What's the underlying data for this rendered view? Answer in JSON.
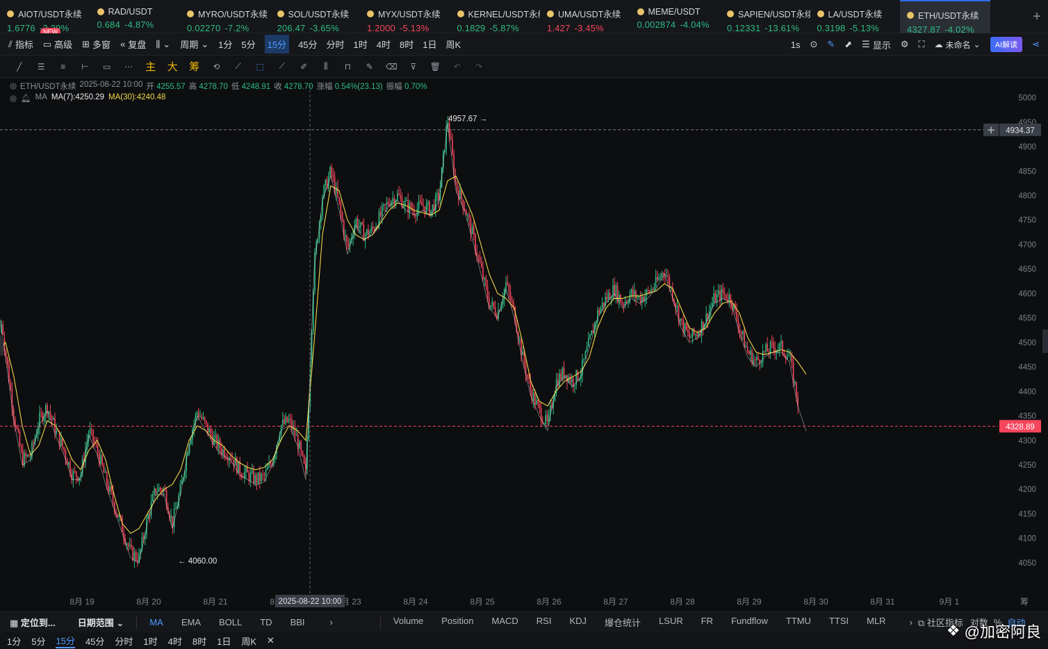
{
  "tickers": [
    {
      "symbol": "AIOT/USDT永续",
      "price": "1.6776",
      "change": "-3.39%",
      "price_color": "green"
    },
    {
      "symbol": "RAD/USDT",
      "price": "0.684",
      "change": "-4.87%",
      "price_color": "green"
    },
    {
      "symbol": "MYRO/USDT永续",
      "price": "0.02270",
      "change": "-7.2%",
      "price_color": "green"
    },
    {
      "symbol": "SOL/USDT永续",
      "price": "206.47",
      "change": "-3.65%",
      "price_color": "green"
    },
    {
      "symbol": "MYX/USDT永续",
      "price": "1.2000",
      "change": "-5.13%",
      "price_color": "red"
    },
    {
      "symbol": "KERNEL/USDT永续",
      "price": "0.1829",
      "change": "-5.87%",
      "price_color": "green"
    },
    {
      "symbol": "UMA/USDT永续",
      "price": "1.427",
      "change": "-3.45%",
      "price_color": "red"
    },
    {
      "symbol": "MEME/USDT",
      "price": "0.002874",
      "change": "-4.04%",
      "price_color": "green"
    },
    {
      "symbol": "SAPIEN/USDT永续",
      "price": "0.12331",
      "change": "-13.61%",
      "price_color": "green"
    },
    {
      "symbol": "LA/USDT永续",
      "price": "0.3198",
      "change": "-5.13%",
      "price_color": "green"
    },
    {
      "symbol": "ETH/USDT永续",
      "price": "4327.87",
      "change": "-4.02%",
      "price_color": "green"
    }
  ],
  "new_badge": "NEW",
  "toolbar": {
    "indicators": "指标",
    "advanced": "高级",
    "multi_window": "多窗",
    "replay": "复盘",
    "period": "周期",
    "periods": [
      "1分",
      "5分",
      "15分",
      "45分",
      "分时",
      "1时",
      "4时",
      "8时",
      "1日",
      "周K"
    ],
    "active_period": "15分",
    "interval": "1s",
    "display": "显示",
    "unnamed": "未命名",
    "ai": "AI解读"
  },
  "legend": {
    "symbol": "ETH/USDT永续",
    "time": "2025-08-22 10:00",
    "open_label": "开",
    "open": "4255.57",
    "high_label": "高",
    "high": "4278.70",
    "low_label": "低",
    "low": "4248.91",
    "close_label": "收",
    "close": "4278.70",
    "change_label": "涨幅",
    "change": "0.54%(23.13)",
    "amp_label": "振幅",
    "amp": "0.70%",
    "ma_label": "MA",
    "ma7": "MA(7):4250.29",
    "ma30": "MA(30):4240.48"
  },
  "chart_data": {
    "type": "candlestick",
    "symbol": "ETH/USDT永续",
    "interval": "15m",
    "y_ticks": [
      5000,
      4950,
      4900,
      4850,
      4800,
      4750,
      4700,
      4650,
      4600,
      4550,
      4500,
      4450,
      4400,
      4350,
      4300,
      4250,
      4200,
      4150,
      4100,
      4050
    ],
    "ylim": [
      4030,
      5015
    ],
    "x_labels": [
      "8月 19",
      "8月 20",
      "8月 21",
      "8月 22",
      "8月 23",
      "8月 24",
      "8月 25",
      "8月 26",
      "8月 27",
      "8月 28",
      "8月 29",
      "8月 30",
      "8月 31",
      "9月 1"
    ],
    "crosshair_time": "2025-08-22 10:00",
    "crosshair_price": "4934.37",
    "last_price": "4328.89",
    "max_annotation": "4957.67",
    "min_annotation": "4060.00",
    "series": [
      {
        "name": "MA(7)"
      },
      {
        "name": "MA(30)"
      }
    ],
    "price_path": [
      [
        0,
        4520
      ],
      [
        0.3,
        4560
      ],
      [
        1,
        4480
      ],
      [
        2,
        4350
      ],
      [
        3,
        4260
      ],
      [
        4,
        4270
      ],
      [
        5,
        4340
      ],
      [
        6,
        4370
      ],
      [
        7,
        4320
      ],
      [
        8,
        4280
      ],
      [
        9,
        4230
      ],
      [
        10,
        4230
      ],
      [
        11,
        4320
      ],
      [
        12,
        4280
      ],
      [
        13,
        4220
      ],
      [
        14,
        4170
      ],
      [
        15,
        4120
      ],
      [
        16,
        4070
      ],
      [
        17,
        4060
      ],
      [
        18,
        4140
      ],
      [
        19,
        4200
      ],
      [
        20,
        4200
      ],
      [
        21,
        4130
      ],
      [
        22,
        4200
      ],
      [
        23,
        4300
      ],
      [
        24,
        4360
      ],
      [
        25,
        4330
      ],
      [
        26,
        4300
      ],
      [
        27,
        4280
      ],
      [
        28,
        4270
      ],
      [
        29,
        4240
      ],
      [
        30,
        4230
      ],
      [
        31,
        4220
      ],
      [
        32,
        4225
      ],
      [
        33,
        4260
      ],
      [
        34,
        4330
      ],
      [
        35,
        4340
      ],
      [
        36,
        4300
      ],
      [
        37,
        4230
      ],
      [
        38,
        4660
      ],
      [
        39,
        4800
      ],
      [
        40,
        4850
      ],
      [
        41,
        4780
      ],
      [
        42,
        4690
      ],
      [
        43,
        4750
      ],
      [
        44,
        4720
      ],
      [
        45,
        4730
      ],
      [
        46,
        4760
      ],
      [
        47,
        4790
      ],
      [
        48,
        4800
      ],
      [
        49,
        4780
      ],
      [
        50,
        4770
      ],
      [
        51,
        4780
      ],
      [
        52,
        4770
      ],
      [
        53,
        4800
      ],
      [
        54,
        4957.67
      ],
      [
        55,
        4820
      ],
      [
        56,
        4780
      ],
      [
        57,
        4720
      ],
      [
        58,
        4650
      ],
      [
        59,
        4580
      ],
      [
        60,
        4560
      ],
      [
        61,
        4620
      ],
      [
        62,
        4560
      ],
      [
        63,
        4470
      ],
      [
        64,
        4400
      ],
      [
        65,
        4360
      ],
      [
        66,
        4330
      ],
      [
        67,
        4420
      ],
      [
        68,
        4440
      ],
      [
        69,
        4420
      ],
      [
        70,
        4440
      ],
      [
        71,
        4500
      ],
      [
        72,
        4560
      ],
      [
        73,
        4590
      ],
      [
        74,
        4610
      ],
      [
        75,
        4580
      ],
      [
        76,
        4600
      ],
      [
        77,
        4590
      ],
      [
        78,
        4600
      ],
      [
        79,
        4620
      ],
      [
        80,
        4650
      ],
      [
        81,
        4600
      ],
      [
        82,
        4540
      ],
      [
        83,
        4510
      ],
      [
        84,
        4520
      ],
      [
        85,
        4550
      ],
      [
        86,
        4590
      ],
      [
        87,
        4600
      ],
      [
        88,
        4590
      ],
      [
        89,
        4530
      ],
      [
        90,
        4480
      ],
      [
        91,
        4460
      ],
      [
        92,
        4480
      ],
      [
        93,
        4490
      ],
      [
        94,
        4490
      ],
      [
        95,
        4470
      ],
      [
        96,
        4380
      ],
      [
        97,
        4328.89
      ]
    ],
    "ma30_path": [
      [
        0,
        4480
      ],
      [
        1,
        4500
      ],
      [
        2,
        4430
      ],
      [
        3,
        4330
      ],
      [
        4,
        4270
      ],
      [
        5,
        4290
      ],
      [
        6,
        4340
      ],
      [
        7,
        4330
      ],
      [
        8,
        4300
      ],
      [
        9,
        4260
      ],
      [
        10,
        4240
      ],
      [
        11,
        4280
      ],
      [
        12,
        4300
      ],
      [
        13,
        4260
      ],
      [
        14,
        4190
      ],
      [
        15,
        4130
      ],
      [
        16,
        4110
      ],
      [
        17,
        4120
      ],
      [
        18,
        4150
      ],
      [
        19,
        4180
      ],
      [
        20,
        4200
      ],
      [
        21,
        4210
      ],
      [
        22,
        4240
      ],
      [
        23,
        4300
      ],
      [
        24,
        4330
      ],
      [
        25,
        4320
      ],
      [
        26,
        4300
      ],
      [
        27,
        4290
      ],
      [
        28,
        4270
      ],
      [
        29,
        4255
      ],
      [
        30,
        4245
      ],
      [
        31,
        4240
      ],
      [
        32,
        4245
      ],
      [
        33,
        4260
      ],
      [
        34,
        4300
      ],
      [
        35,
        4330
      ],
      [
        36,
        4320
      ],
      [
        37,
        4300
      ],
      [
        38,
        4500
      ],
      [
        39,
        4720
      ],
      [
        40,
        4820
      ],
      [
        41,
        4810
      ],
      [
        42,
        4750
      ],
      [
        43,
        4720
      ],
      [
        44,
        4710
      ],
      [
        45,
        4720
      ],
      [
        46,
        4745
      ],
      [
        47,
        4770
      ],
      [
        48,
        4785
      ],
      [
        49,
        4780
      ],
      [
        50,
        4770
      ],
      [
        51,
        4765
      ],
      [
        52,
        4760
      ],
      [
        53,
        4770
      ],
      [
        54,
        4830
      ],
      [
        55,
        4840
      ],
      [
        56,
        4800
      ],
      [
        57,
        4760
      ],
      [
        58,
        4700
      ],
      [
        59,
        4640
      ],
      [
        60,
        4600
      ],
      [
        61,
        4590
      ],
      [
        62,
        4570
      ],
      [
        63,
        4500
      ],
      [
        64,
        4420
      ],
      [
        65,
        4380
      ],
      [
        66,
        4370
      ],
      [
        67,
        4400
      ],
      [
        68,
        4420
      ],
      [
        69,
        4430
      ],
      [
        70,
        4440
      ],
      [
        71,
        4470
      ],
      [
        72,
        4530
      ],
      [
        73,
        4570
      ],
      [
        74,
        4590
      ],
      [
        75,
        4590
      ],
      [
        76,
        4595
      ],
      [
        77,
        4595
      ],
      [
        78,
        4600
      ],
      [
        79,
        4605
      ],
      [
        80,
        4620
      ],
      [
        81,
        4610
      ],
      [
        82,
        4570
      ],
      [
        83,
        4530
      ],
      [
        84,
        4520
      ],
      [
        85,
        4530
      ],
      [
        86,
        4560
      ],
      [
        87,
        4580
      ],
      [
        88,
        4585
      ],
      [
        89,
        4560
      ],
      [
        90,
        4510
      ],
      [
        91,
        4480
      ],
      [
        92,
        4475
      ],
      [
        93,
        4480
      ],
      [
        94,
        4485
      ],
      [
        95,
        4480
      ],
      [
        96,
        4460
      ],
      [
        97,
        4435
      ]
    ]
  },
  "bottom_bar": {
    "locate": "定位到...",
    "date_range": "日期范围",
    "indicators": [
      "MA",
      "EMA",
      "BOLL",
      "TD",
      "BBI"
    ],
    "sub_indicators": [
      "Volume",
      "Position",
      "MACD",
      "RSI",
      "KDJ",
      "爆仓统计",
      "LSUR",
      "FR",
      "Fundflow",
      "TTMU",
      "TTSI",
      "MLR"
    ],
    "community": "社区指标",
    "log": "对数",
    "percent": "%",
    "auto": "自动"
  },
  "bottom_periods": [
    "1分",
    "5分",
    "15分",
    "45分",
    "分时",
    "1时",
    "4时",
    "8时",
    "1日",
    "周K"
  ],
  "bottom_active": "15分",
  "watermark": "@加密阿良",
  "colors": {
    "up": "#2ebd85",
    "down": "#f6465d",
    "ma7": "#e8e8e8",
    "ma30": "#f0d84a",
    "accent": "#4f9cff"
  }
}
